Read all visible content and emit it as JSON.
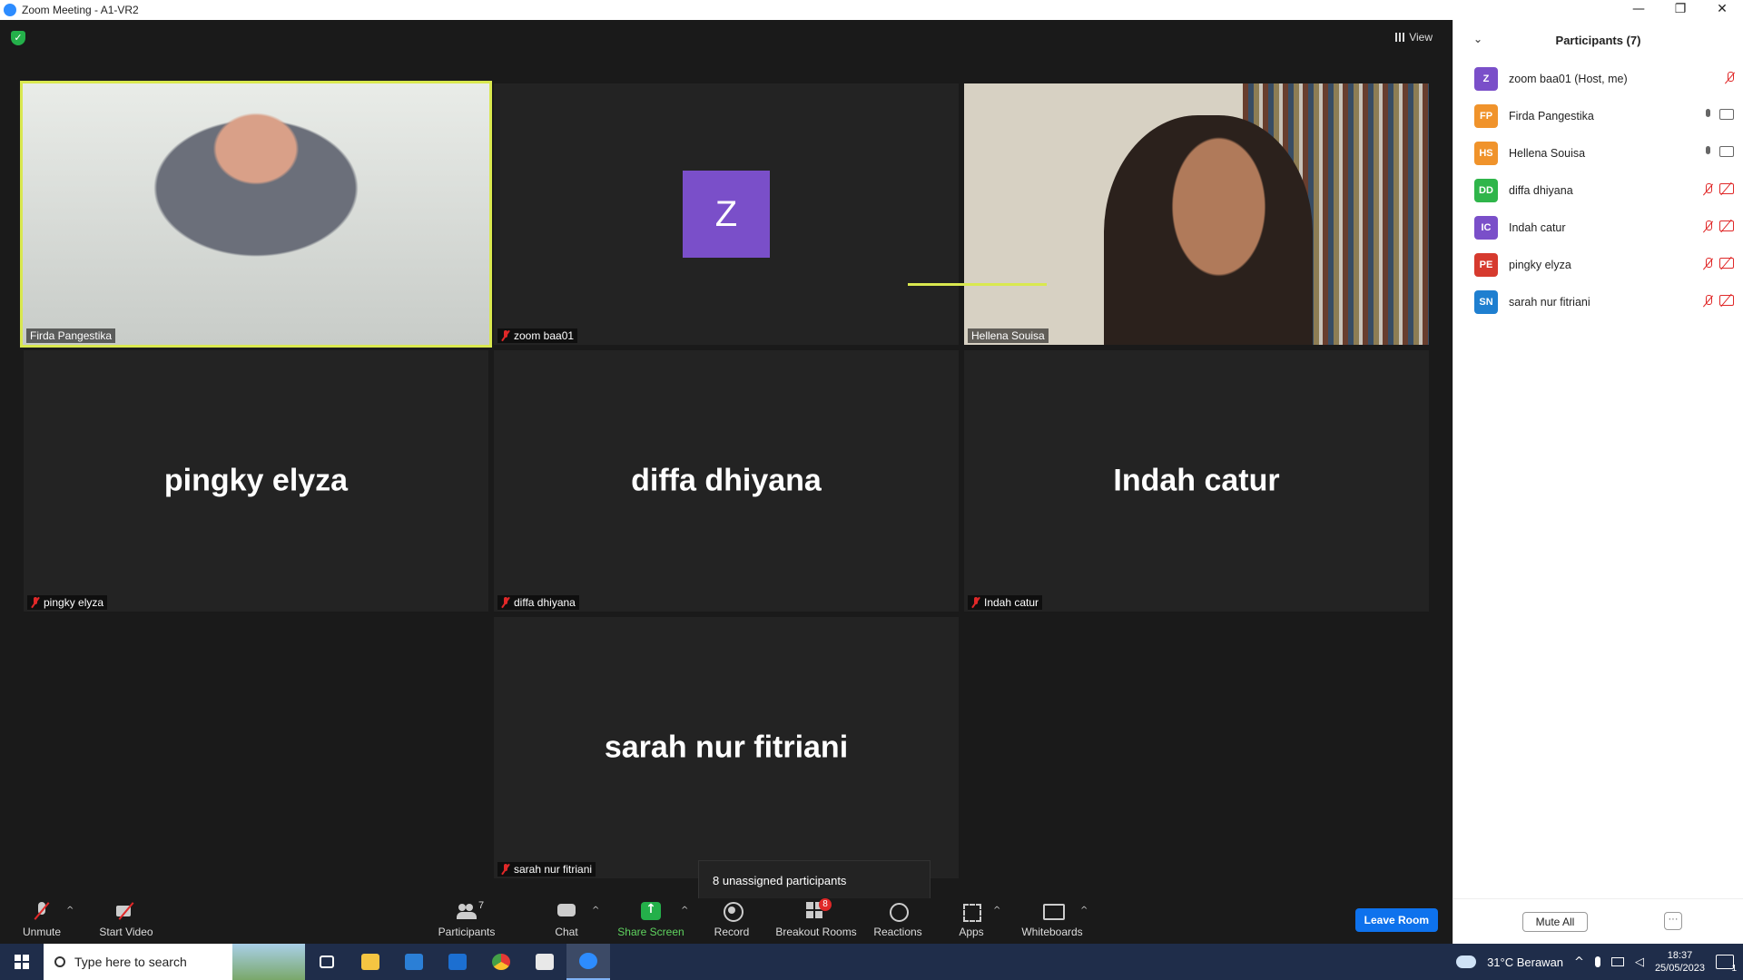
{
  "window": {
    "title": "Zoom Meeting - A1-VR2",
    "controls": [
      "—",
      "❐",
      "✕"
    ]
  },
  "meeting": {
    "view_label": "View",
    "tiles": [
      {
        "name": "Firda Pangestika",
        "muted": false,
        "video": true,
        "active": true
      },
      {
        "name": "zoom baa01",
        "muted": true,
        "video": false,
        "avatar_letter": "Z"
      },
      {
        "name": "Hellena Souisa",
        "muted": false,
        "video": true
      },
      {
        "name": "pingky elyza",
        "muted": true,
        "video": false,
        "big_name": "pingky elyza"
      },
      {
        "name": "diffa dhiyana",
        "muted": true,
        "video": false,
        "big_name": "diffa dhiyana"
      },
      {
        "name": "Indah catur",
        "muted": true,
        "video": false,
        "big_name": "Indah catur"
      },
      {
        "name": "sarah nur fitriani",
        "muted": true,
        "video": false,
        "big_name": "sarah nur fitriani"
      }
    ],
    "tooltip": "8 unassigned participants"
  },
  "toolbar": {
    "unmute": "Unmute",
    "start_video": "Start Video",
    "participants": "Participants",
    "participants_count": "7",
    "chat": "Chat",
    "share_screen": "Share Screen",
    "record": "Record",
    "breakout_rooms": "Breakout Rooms",
    "breakout_badge": "8",
    "reactions": "Reactions",
    "apps": "Apps",
    "whiteboards": "Whiteboards",
    "leave_room": "Leave Room"
  },
  "participants_panel": {
    "title": "Participants (7)",
    "items": [
      {
        "initials": "Z",
        "name": "zoom baa01 (Host, me)",
        "color": "#7a4fc9",
        "mic": "off",
        "cam": "none"
      },
      {
        "initials": "FP",
        "name": "Firda Pangestika",
        "color": "#f0932b",
        "mic": "on",
        "cam": "on"
      },
      {
        "initials": "HS",
        "name": "Hellena Souisa",
        "color": "#f0932b",
        "mic": "on",
        "cam": "on"
      },
      {
        "initials": "DD",
        "name": "diffa dhiyana",
        "color": "#2fb54a",
        "mic": "off",
        "cam": "off"
      },
      {
        "initials": "IC",
        "name": "Indah catur",
        "color": "#7a4fc9",
        "mic": "off",
        "cam": "off"
      },
      {
        "initials": "PE",
        "name": "pingky elyza",
        "color": "#d63a2e",
        "mic": "off",
        "cam": "off"
      },
      {
        "initials": "SN",
        "name": "sarah nur fitriani",
        "color": "#1f7fd0",
        "mic": "off",
        "cam": "off"
      }
    ],
    "mute_all": "Mute All",
    "more": "···"
  },
  "taskbar": {
    "search_placeholder": "Type here to search",
    "weather": "31°C  Berawan",
    "time": "18:37",
    "date": "25/05/2023",
    "notification_count": "1"
  }
}
